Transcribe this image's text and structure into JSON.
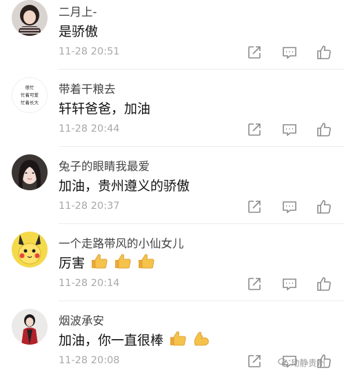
{
  "comments": [
    {
      "username": "二月上-",
      "text": "是骄傲",
      "time": "11-28 20:51",
      "emoji_icons": []
    },
    {
      "username": "带着干粮去",
      "text": "轩轩爸爸，加油",
      "time": "11-28 20:44",
      "emoji_icons": [],
      "avatar_text": [
        "很忙",
        "忙着可爱",
        "忙着长大"
      ]
    },
    {
      "username": "兔子的眼睛我最爱",
      "text": "加油，贵州遵义的骄傲",
      "time": "11-28 20:37",
      "emoji_icons": []
    },
    {
      "username": "一个走路带风的小仙女儿",
      "text": "厉害",
      "time": "11-28 20:14",
      "emoji_icons": [
        "thumbs-up-icon",
        "thumbs-up-icon",
        "thumbs-up-icon"
      ]
    },
    {
      "username": "烟波承安",
      "text": "加油，你一直很棒",
      "time": "11-28 20:08",
      "emoji_icons": [
        "thumbs-up-icon",
        "flexed-biceps-icon"
      ]
    }
  ],
  "actions": [
    "share-icon",
    "reply-icon",
    "like-icon"
  ],
  "colors": {
    "username": "#444444",
    "text": "#111111",
    "time": "#a8a8a8",
    "icon": "#8a8a8a",
    "emoji": "#f5c24b"
  },
  "watermark": {
    "text": "动静贵州"
  }
}
